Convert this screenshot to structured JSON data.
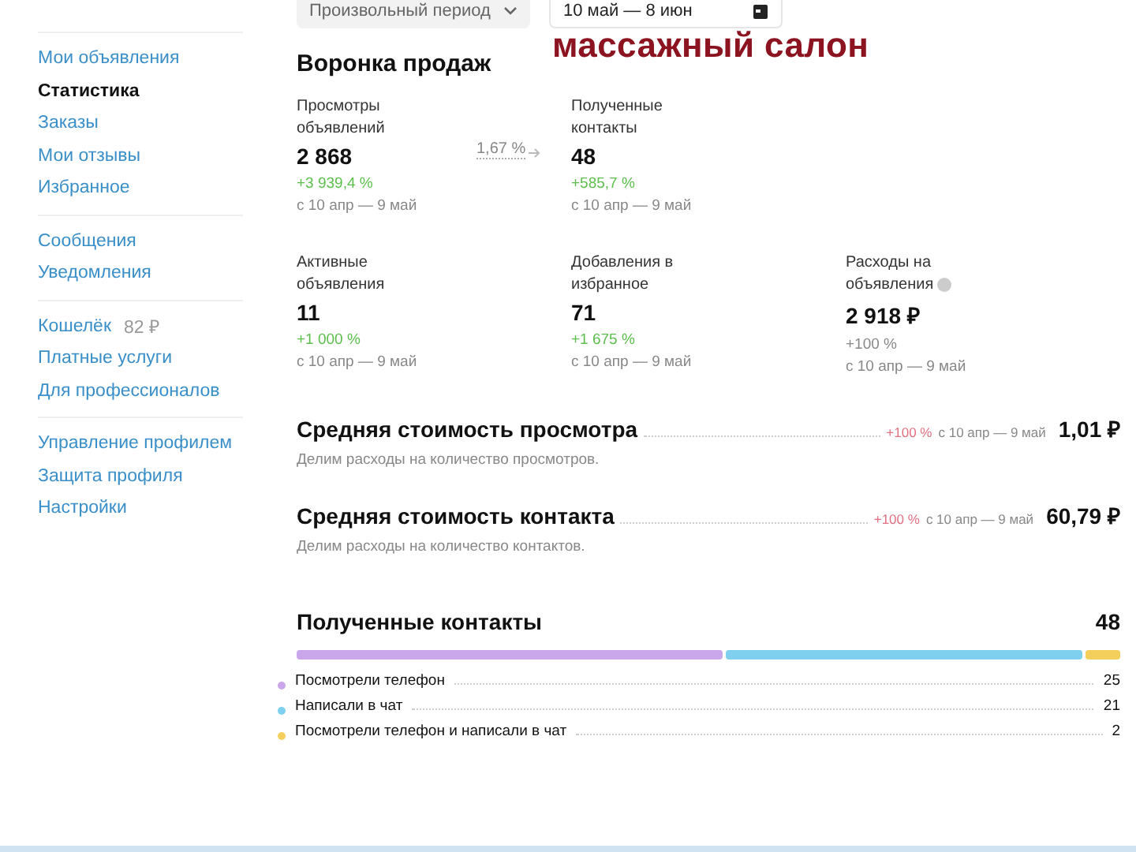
{
  "sidebar": {
    "groups": [
      {
        "items": [
          {
            "label": "Мои объявления",
            "selected": false
          },
          {
            "label": "Статистика",
            "selected": true
          },
          {
            "label": "Заказы",
            "selected": false
          },
          {
            "label": "Мои отзывы",
            "selected": false
          },
          {
            "label": "Избранное",
            "selected": false
          }
        ]
      },
      {
        "items": [
          {
            "label": "Сообщения",
            "selected": false
          },
          {
            "label": "Уведомления",
            "selected": false
          }
        ]
      },
      {
        "items": [
          {
            "label": "Кошелёк",
            "selected": false,
            "extra": "82 ₽"
          },
          {
            "label": "Платные услуги",
            "selected": false
          },
          {
            "label": "Для профессионалов",
            "selected": false
          }
        ]
      },
      {
        "items": [
          {
            "label": "Управление профилем",
            "selected": false
          },
          {
            "label": "Защита профиля",
            "selected": false
          },
          {
            "label": "Настройки",
            "selected": false
          }
        ]
      }
    ]
  },
  "period_select": {
    "value": "Произвольный период"
  },
  "date_range": {
    "value": "10 май — 8 июн"
  },
  "caption": "массажный салон",
  "funnel": {
    "title": "Воронка продаж",
    "conversion": "1,67 %",
    "rows": [
      [
        {
          "label": "Просмотры объявлений",
          "value": "2 868",
          "change": "+3 939,4 %",
          "positive": true,
          "period": "с 10 апр — 9 май"
        },
        {
          "label": "Полученные контакты",
          "value": "48",
          "change": "+585,7 %",
          "positive": true,
          "period": "с 10 апр — 9 май"
        }
      ],
      [
        {
          "label": "Активные объявления",
          "value": "11",
          "change": "+1 000 %",
          "positive": true,
          "period": "с 10 апр — 9 май"
        },
        {
          "label": "Добавления в избранное",
          "value": "71",
          "change": "+1 675 %",
          "positive": true,
          "period": "с 10 апр — 9 май"
        },
        {
          "label": "Расходы на объявления",
          "value": "2 918 ₽",
          "change": "+100 %",
          "positive": false,
          "period": "с 10 апр — 9 май",
          "info": true
        }
      ]
    ]
  },
  "costs": [
    {
      "title": "Средняя стоимость просмотра",
      "change": "+100 %",
      "period": "с 10 апр — 9 май",
      "value": "1,01 ₽",
      "note": "Делим расходы на количество просмотров."
    },
    {
      "title": "Средняя стоимость контакта",
      "change": "+100 %",
      "period": "с 10 апр — 9 май",
      "value": "60,79 ₽",
      "note": "Делим расходы на количество контактов."
    }
  ],
  "contacts": {
    "title": "Полученные контакты",
    "total": "48",
    "items": [
      {
        "label": "Посмотрели телефон",
        "value": "25",
        "color": "#c9a7ea"
      },
      {
        "label": "Написали в чат",
        "value": "21",
        "color": "#7fcfee"
      },
      {
        "label": "Посмотрели телефон и написали в чат",
        "value": "2",
        "color": "#f5cf5b"
      }
    ]
  }
}
